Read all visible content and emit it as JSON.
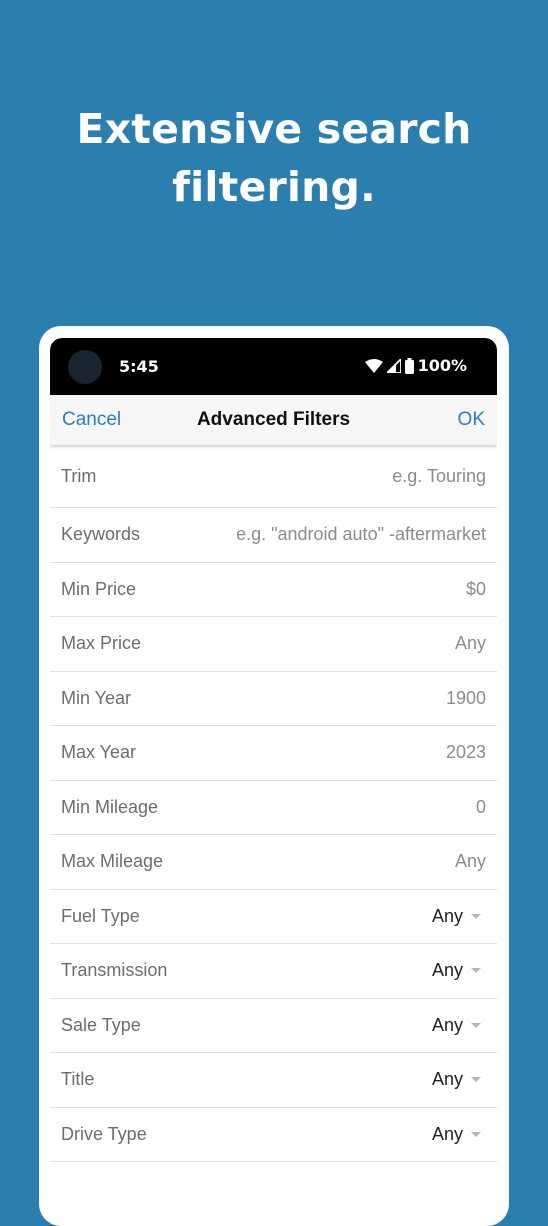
{
  "headline": {
    "line1": "Extensive search",
    "line2": "filtering."
  },
  "status_bar": {
    "time": "5:45",
    "battery": "100%"
  },
  "nav": {
    "cancel": "Cancel",
    "title": "Advanced Filters",
    "ok": "OK"
  },
  "fields": [
    {
      "label": "Trim",
      "placeholder": "e.g. Touring"
    },
    {
      "label": "Keywords",
      "placeholder": "e.g. \"android auto\" -aftermarket"
    },
    {
      "label": "Min Price",
      "placeholder": "$0"
    },
    {
      "label": "Max Price",
      "placeholder": "Any"
    },
    {
      "label": "Min Year",
      "placeholder": "1900"
    },
    {
      "label": "Max Year",
      "placeholder": "2023"
    },
    {
      "label": "Min Mileage",
      "placeholder": "0"
    },
    {
      "label": "Max Mileage",
      "placeholder": "Any"
    }
  ],
  "selects": [
    {
      "label": "Fuel Type",
      "value": "Any"
    },
    {
      "label": "Transmission",
      "value": "Any"
    },
    {
      "label": "Sale Type",
      "value": "Any"
    },
    {
      "label": "Title",
      "value": "Any"
    },
    {
      "label": "Drive Type",
      "value": "Any"
    }
  ],
  "colors": {
    "background": "#2a7fae",
    "accent": "#2a7fbf"
  }
}
